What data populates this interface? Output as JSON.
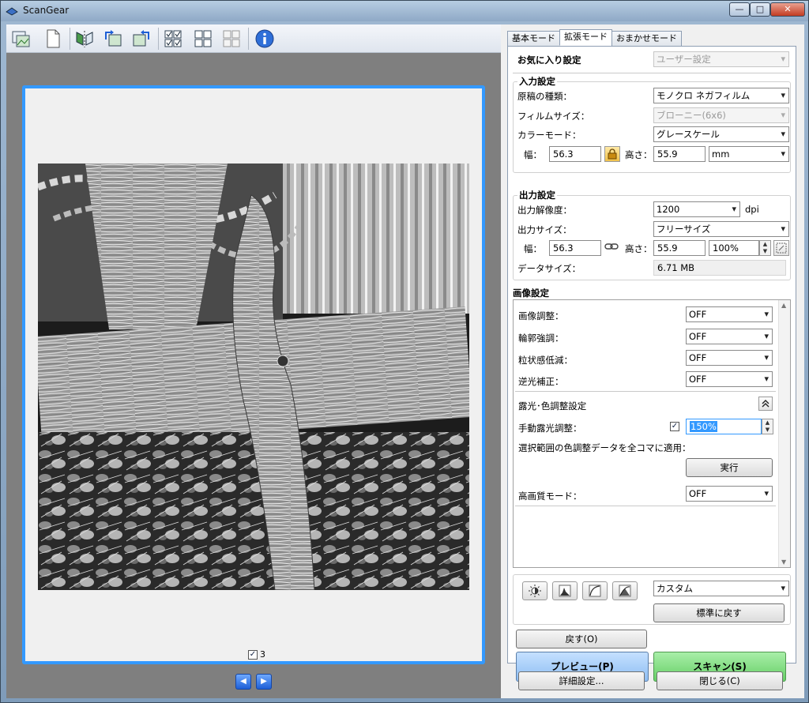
{
  "window": {
    "title": "ScanGear",
    "minimize_glyph": "—",
    "maximize_glyph": "□",
    "close_glyph": "✕"
  },
  "toolbar": {
    "icons": [
      "thumbnail-view-icon",
      "blank-page-icon",
      "mirror-icon",
      "rotate-left-icon",
      "rotate-right-icon",
      "select-all-frames-icon",
      "grid-view-icon",
      "clear-frames-icon",
      "info-icon"
    ]
  },
  "preview": {
    "frame_number": "3",
    "frame_checked": "✓",
    "prev_glyph": "◀",
    "next_glyph": "▶"
  },
  "tabs": [
    {
      "label": "基本モード"
    },
    {
      "label": "拡張モード"
    },
    {
      "label": "おまかせモード"
    }
  ],
  "favorites": {
    "label": "お気に入り設定",
    "value": "ユーザー設定"
  },
  "input_settings": {
    "title": "入力設定",
    "source_label": "原稿の種類：",
    "source_value": "モノクロ ネガフィルム",
    "film_size_label": "フィルムサイズ：",
    "film_size_value": "ブローニー(6x6)",
    "color_mode_label": "カラーモード：",
    "color_mode_value": "グレースケール",
    "width_label": "幅：",
    "width_value": "56.3",
    "height_label": "高さ：",
    "height_value": "55.9",
    "unit_value": "mm"
  },
  "output_settings": {
    "title": "出力設定",
    "resolution_label": "出力解像度：",
    "resolution_value": "1200",
    "resolution_unit": "dpi",
    "output_size_label": "出力サイズ：",
    "output_size_value": "フリーサイズ",
    "width_label": "幅：",
    "width_value": "56.3",
    "height_label": "高さ：",
    "height_value": "55.9",
    "scale_value": "100%",
    "data_size_label": "データサイズ：",
    "data_size_value": "6.71 MB"
  },
  "image_settings": {
    "title": "画像設定",
    "items": [
      {
        "label": "画像調整：",
        "value": "OFF"
      },
      {
        "label": "輪郭強調：",
        "value": "OFF"
      },
      {
        "label": "粒状感低減：",
        "value": "OFF"
      },
      {
        "label": "逆光補正：",
        "value": "OFF"
      }
    ],
    "exposure_section_label": "露光･色調整設定",
    "manual_exposure_label": "手動露光調整：",
    "manual_exposure_checked": "✓",
    "manual_exposure_value": "150%",
    "apply_all_label": "選択範囲の色調整データを全コマに適用：",
    "execute_button": "実行",
    "high_quality_label": "高画質モード：",
    "high_quality_value": "OFF"
  },
  "tone_tools": {
    "preset_value": "カスタム",
    "reset_button": "標準に戻す"
  },
  "buttons": {
    "back": "戻す(O)",
    "preview": "プレビュー(P)",
    "scan": "スキャン(S)",
    "preferences": "詳細設定...",
    "close": "閉じる(C)"
  },
  "colors": {
    "frame_border": "#3399ff",
    "preview_button": "#9fcaf7",
    "scan_button": "#7bd97b"
  }
}
